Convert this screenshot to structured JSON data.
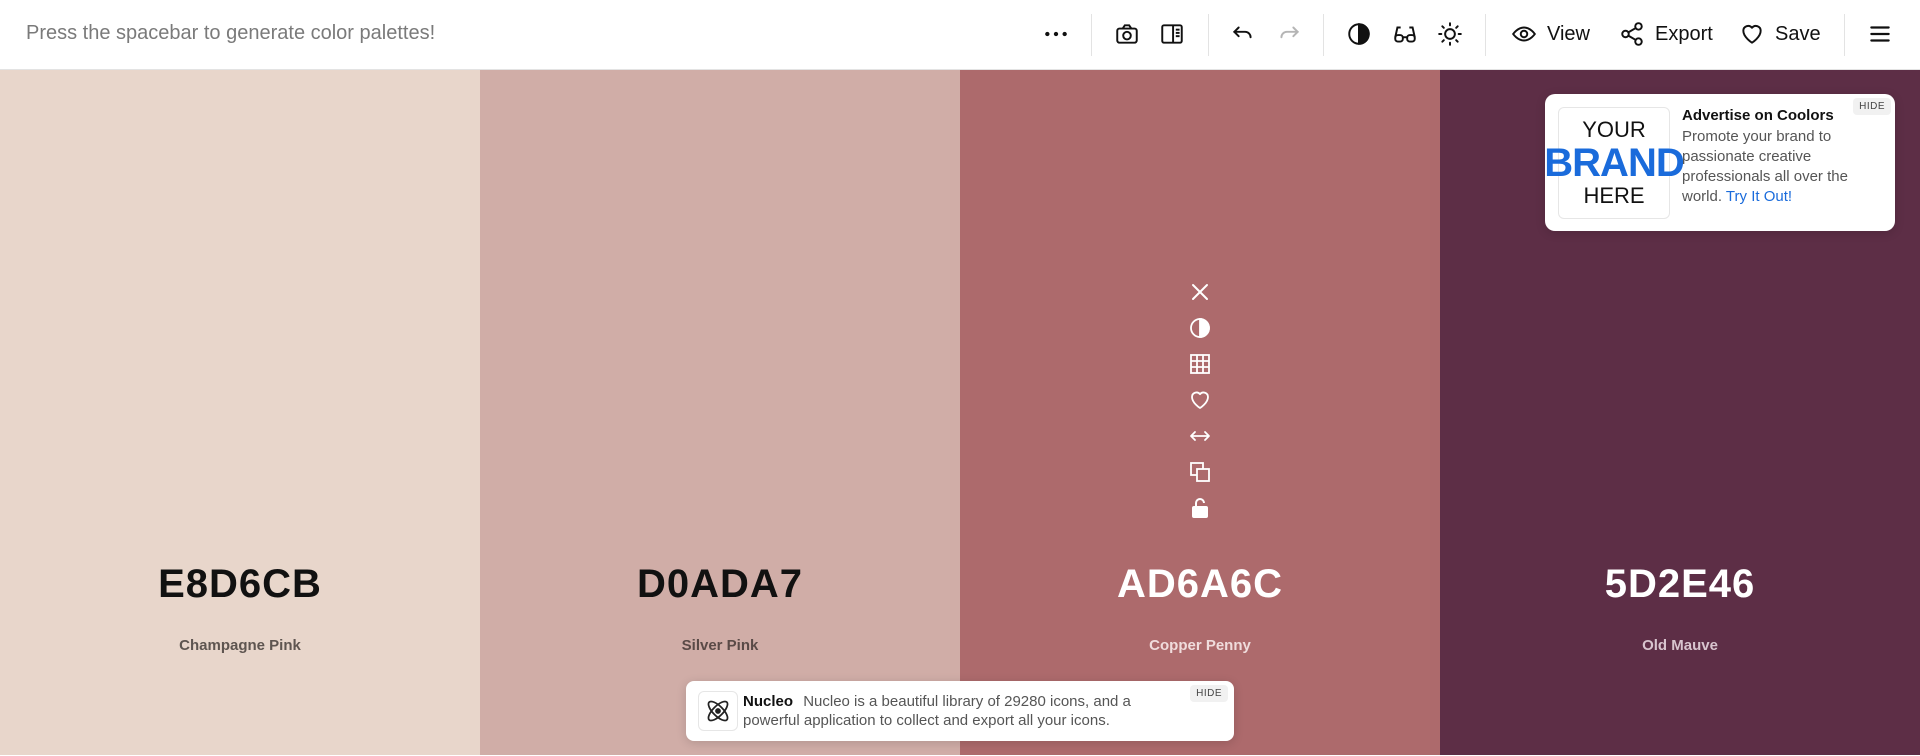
{
  "toolbar": {
    "hint": "Press the spacebar to generate color palettes!",
    "view_label": "View",
    "export_label": "Export",
    "save_label": "Save",
    "icons": [
      "more-icon",
      "camera-icon",
      "sidebar-icon",
      "undo-icon",
      "redo-icon",
      "contrast-icon",
      "glasses-icon",
      "sun-icon",
      "eye-icon",
      "share-icon",
      "heart-icon",
      "menu-icon"
    ]
  },
  "palette": {
    "swatches": [
      {
        "hex": "E8D6CB",
        "name": "Champagne Pink",
        "color": "#E8D6CB",
        "text_color": "#111111",
        "name_color": "#5e5550"
      },
      {
        "hex": "D0ADA7",
        "name": "Silver Pink",
        "color": "#D0ADA7",
        "text_color": "#111111",
        "name_color": "#5a4a47"
      },
      {
        "hex": "AD6A6C",
        "name": "Copper Penny",
        "color": "#AD6A6C",
        "text_color": "#ffffff",
        "name_color": "#f0dcdc"
      },
      {
        "hex": "5D2E46",
        "name": "Old Mauve",
        "color": "#5D2E46",
        "text_color": "#ffffff",
        "name_color": "#d8c4ce"
      }
    ],
    "hover_tools": [
      "close-icon",
      "contrast-icon",
      "shades-grid-icon",
      "heart-icon",
      "drag-icon",
      "copy-icon",
      "unlock-icon"
    ]
  },
  "ad": {
    "logo_line1": "YOUR",
    "logo_line2": "BRAND",
    "logo_line3": "HERE",
    "title": "Advertise on Coolors",
    "body": "Promote your brand to passionate creative professionals all over the world.",
    "link": "Try It Out!",
    "hide": "HIDE"
  },
  "nucleo": {
    "title": "Nucleo",
    "body": "Nucleo is a beautiful library of 29280 icons, and a powerful application to collect and export all your icons.",
    "hide": "HIDE"
  }
}
